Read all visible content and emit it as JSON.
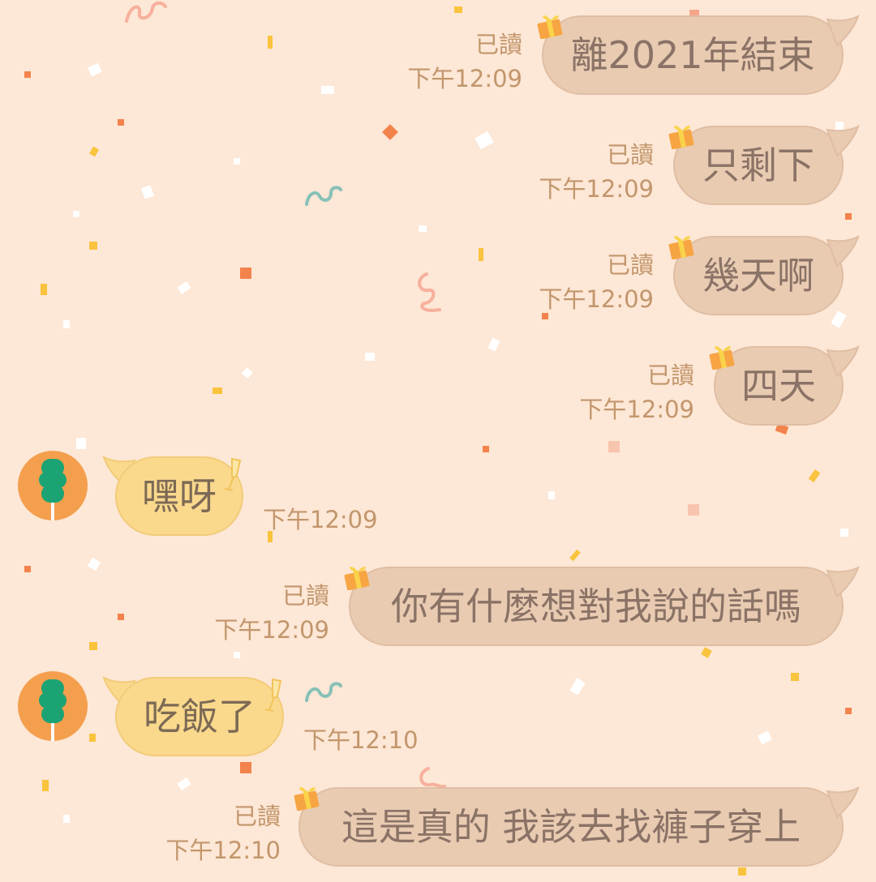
{
  "theme": {
    "background": "#fde7d6",
    "sent_bubble": "#e9cbb2",
    "received_bubble": "#fad98d",
    "meta_text": "#c2966c",
    "avatar_bg": "#f49f4d",
    "avatar_figure": "#1ba374"
  },
  "chat": {
    "messages": [
      {
        "side": "sent",
        "text": "離2021年結束",
        "read": "已讀",
        "time": "下午12:09",
        "icon": "gift-icon"
      },
      {
        "side": "sent",
        "text": "只剩下",
        "read": "已讀",
        "time": "下午12:09",
        "icon": "gift-icon"
      },
      {
        "side": "sent",
        "text": "幾天啊",
        "read": "已讀",
        "time": "下午12:09",
        "icon": "gift-icon"
      },
      {
        "side": "sent",
        "text": "四天",
        "read": "已讀",
        "time": "下午12:09",
        "icon": "gift-icon"
      },
      {
        "side": "received",
        "text": "嘿呀",
        "time": "下午12:09",
        "icon": "champagne-glass-icon",
        "avatar_icon": "dango-avatar-icon"
      },
      {
        "side": "sent",
        "text": "你有什麼想對我說的話嗎",
        "read": "已讀",
        "time": "下午12:09",
        "icon": "gift-icon"
      },
      {
        "side": "received",
        "text": "吃飯了",
        "time": "下午12:10",
        "icon": "champagne-glass-icon",
        "avatar_icon": "dango-avatar-icon"
      },
      {
        "side": "sent",
        "text": "這是真的 我該去找褲子穿上",
        "read": "已讀",
        "time": "下午12:10",
        "icon": "gift-icon"
      }
    ]
  }
}
